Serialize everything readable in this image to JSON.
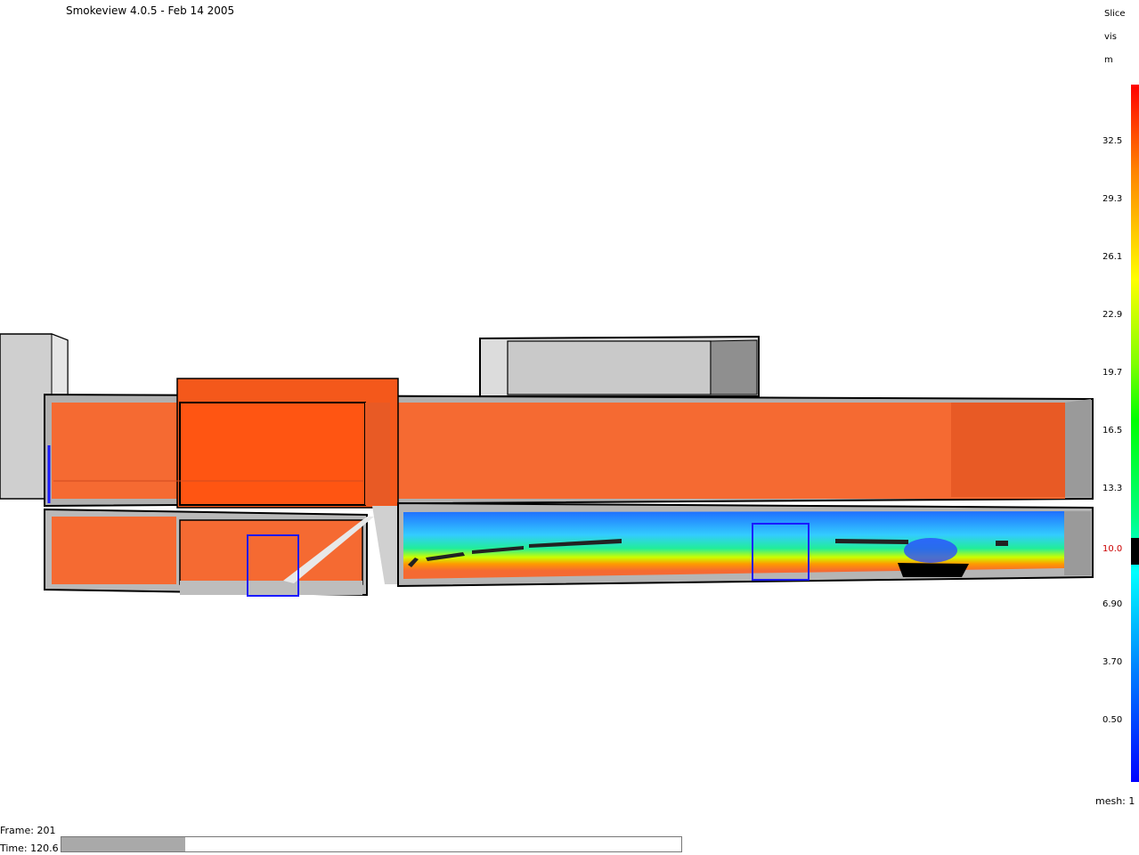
{
  "app": {
    "title": "Smokeview 4.0.5  -  Feb 14 2005"
  },
  "legend": {
    "header": [
      "Slice",
      "vis",
      "m"
    ],
    "ticks": [
      "32.5",
      "29.3",
      "26.1",
      "22.9",
      "19.7",
      "16.5",
      "13.3",
      "10.0",
      "6.90",
      "3.70",
      "0.50"
    ],
    "current_value": "10.0",
    "colors": {
      "max": "#ff0000",
      "min": "#0000ff",
      "current": "#cc0000"
    }
  },
  "mesh_label": "mesh: 1",
  "status": {
    "frame_label": "Frame: 201",
    "time_label": "Time: 120.6",
    "time_progress": 0.2
  },
  "scene_colors": {
    "fill_orange": "#f56a32",
    "gray": "#cfcfcf",
    "outline": "#000000"
  }
}
